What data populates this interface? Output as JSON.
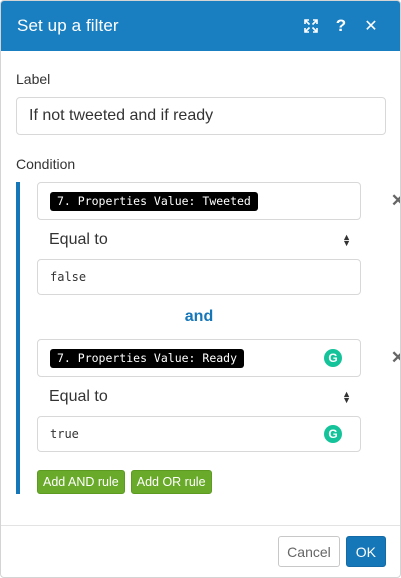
{
  "header": {
    "title": "Set up a filter",
    "expand_icon": "expand-arrows-icon",
    "help_icon": "question-icon",
    "close_icon": "close-icon",
    "help_glyph": "?",
    "close_glyph": "✕",
    "expand_glyph": "⤢"
  },
  "label_section": {
    "label": "Label",
    "value": "If not tweeted and if ready"
  },
  "condition_section": {
    "label": "Condition",
    "rules": [
      {
        "field": "7. Properties Value: Tweeted",
        "operator": "Equal to",
        "value": "false"
      },
      {
        "field": "7. Properties Value: Ready",
        "operator": "Equal to",
        "value": "true"
      }
    ],
    "connector": "and",
    "add_and_label": "Add AND rule",
    "add_or_label": "Add OR rule"
  },
  "footer": {
    "cancel_label": "Cancel",
    "ok_label": "OK"
  },
  "colors": {
    "header_bg": "#1a7fc1",
    "accent": "#1576b8",
    "green": "#6aaa2a",
    "grammarly": "#15c39a"
  }
}
